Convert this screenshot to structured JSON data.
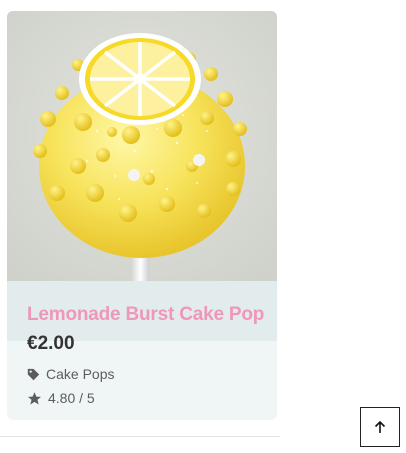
{
  "product": {
    "title": "Lemonade Burst Cake Pop",
    "price": "€2.00",
    "category": "Cake Pops",
    "rating": "4.80 / 5",
    "image_icon": "lemon-cake-pop-photo"
  },
  "icons": {
    "category": "tag-icon",
    "rating": "star-icon",
    "back_to_top": "arrow-up-icon"
  },
  "colors": {
    "title": "#ef97ba",
    "price": "#333333",
    "meta_text": "#5c5c5c",
    "card_background": "#f0f6f6",
    "title_band": "#e3ecec"
  }
}
